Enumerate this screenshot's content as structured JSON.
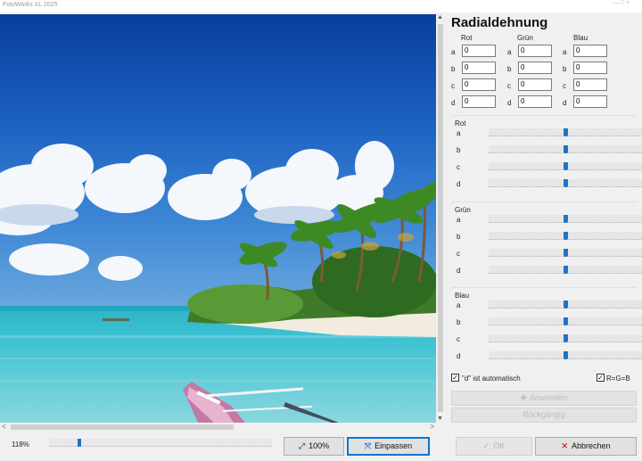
{
  "window": {
    "title": "FotoWorks XL 2025",
    "controls": "— □ ×"
  },
  "panel": {
    "title": "Radialdehnung",
    "columns": [
      "Rot",
      "Grün",
      "Blau"
    ],
    "params": [
      "a",
      "b",
      "c",
      "d"
    ],
    "values": {
      "rot": {
        "a": "0",
        "b": "0",
        "c": "0",
        "d": "0"
      },
      "gruen": {
        "a": "0",
        "b": "0",
        "c": "0",
        "d": "0"
      },
      "blau": {
        "a": "0",
        "b": "0",
        "c": "0",
        "d": "0"
      }
    },
    "slider_groups": [
      {
        "label": "Rot",
        "levels": {
          "a": 0.5,
          "b": 0.5,
          "c": 0.5,
          "d": 0.5
        }
      },
      {
        "label": "Grün",
        "levels": {
          "a": 0.5,
          "b": 0.5,
          "c": 0.5,
          "d": 0.5
        }
      },
      {
        "label": "Blau",
        "levels": {
          "a": 0.5,
          "b": 0.5,
          "c": 0.5,
          "d": 0.5
        }
      }
    ],
    "d_auto": {
      "label": "\"d\" ist automatisch",
      "checked": true
    },
    "rgb_link": {
      "label": "R=G=B",
      "checked": true
    },
    "apply_label": "Anwenden",
    "undo_label": "Rückgängig"
  },
  "bottom": {
    "zoom_text": "118%",
    "zoom_level": 0.13,
    "btn_100": "100%",
    "btn_fit": "Einpassen",
    "btn_ok": "OK",
    "btn_cancel": "Abbrechen"
  },
  "icons": {
    "check": "✓",
    "cross": "✕",
    "fit": "⤧",
    "full": "⤢",
    "apply": "✚"
  },
  "colors": {
    "accent": "#1e73c8",
    "cancel": "#d0352b"
  }
}
